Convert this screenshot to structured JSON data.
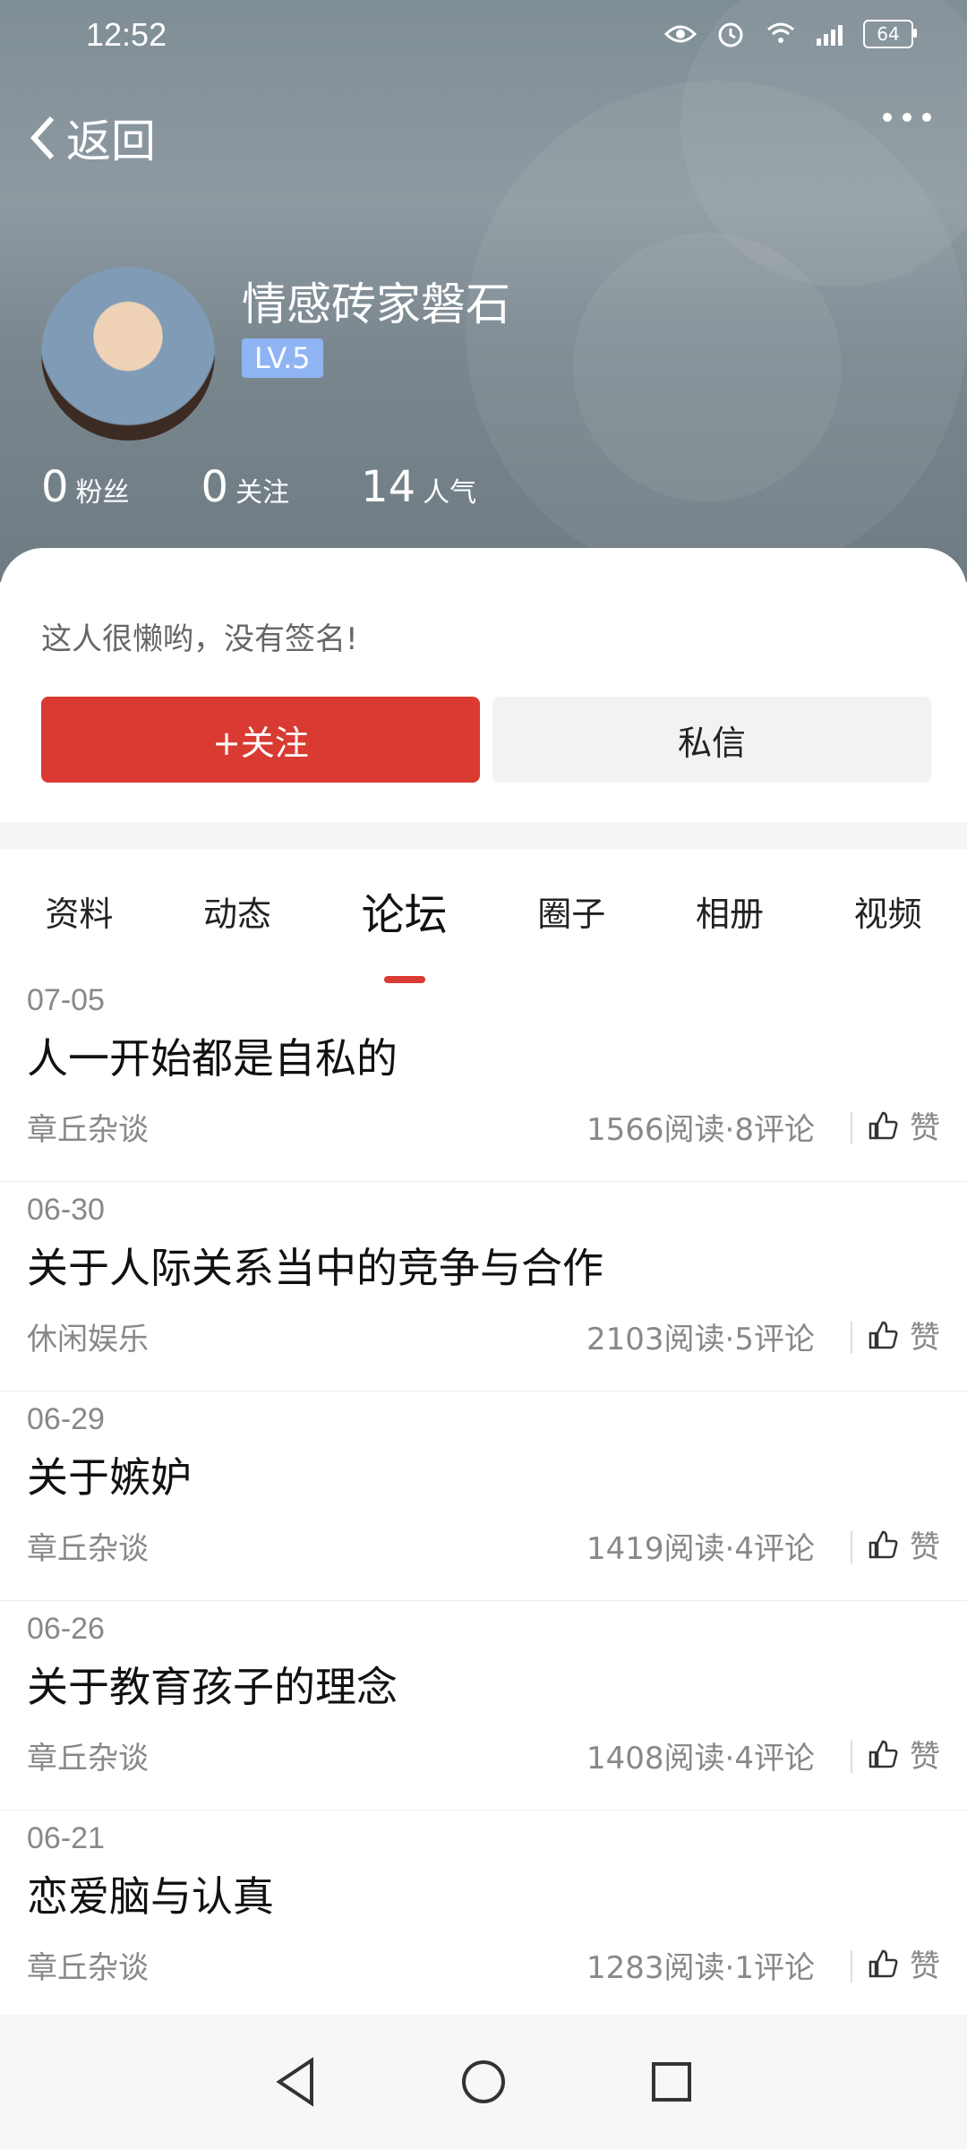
{
  "status": {
    "time": "12:52",
    "battery": "64"
  },
  "header": {
    "back_label": "返回"
  },
  "profile": {
    "name": "情感砖家磐石",
    "level": "LV.5",
    "followers": "0",
    "followers_label": "粉丝",
    "following": "0",
    "following_label": "关注",
    "popularity": "14",
    "popularity_label": "人气"
  },
  "card": {
    "signature": "这人很懒哟，没有签名!",
    "follow_btn": "+关注",
    "message_btn": "私信"
  },
  "tabs": [
    {
      "label": "资料"
    },
    {
      "label": "动态"
    },
    {
      "label": "论坛"
    },
    {
      "label": "圈子"
    },
    {
      "label": "相册"
    },
    {
      "label": "视频"
    }
  ],
  "posts": [
    {
      "date": "07-05",
      "title": "人一开始都是自私的",
      "category": "章丘杂谈",
      "meta": "1566阅读·8评论",
      "like": "赞"
    },
    {
      "date": "06-30",
      "title": "关于人际关系当中的竞争与合作",
      "category": "休闲娱乐",
      "meta": "2103阅读·5评论",
      "like": "赞"
    },
    {
      "date": "06-29",
      "title": "关于嫉妒",
      "category": "章丘杂谈",
      "meta": "1419阅读·4评论",
      "like": "赞"
    },
    {
      "date": "06-26",
      "title": "关于教育孩子的理念",
      "category": "章丘杂谈",
      "meta": "1408阅读·4评论",
      "like": "赞"
    },
    {
      "date": "06-21",
      "title": "恋爱脑与认真",
      "category": "章丘杂谈",
      "meta": "1283阅读·1评论",
      "like": "赞"
    }
  ]
}
